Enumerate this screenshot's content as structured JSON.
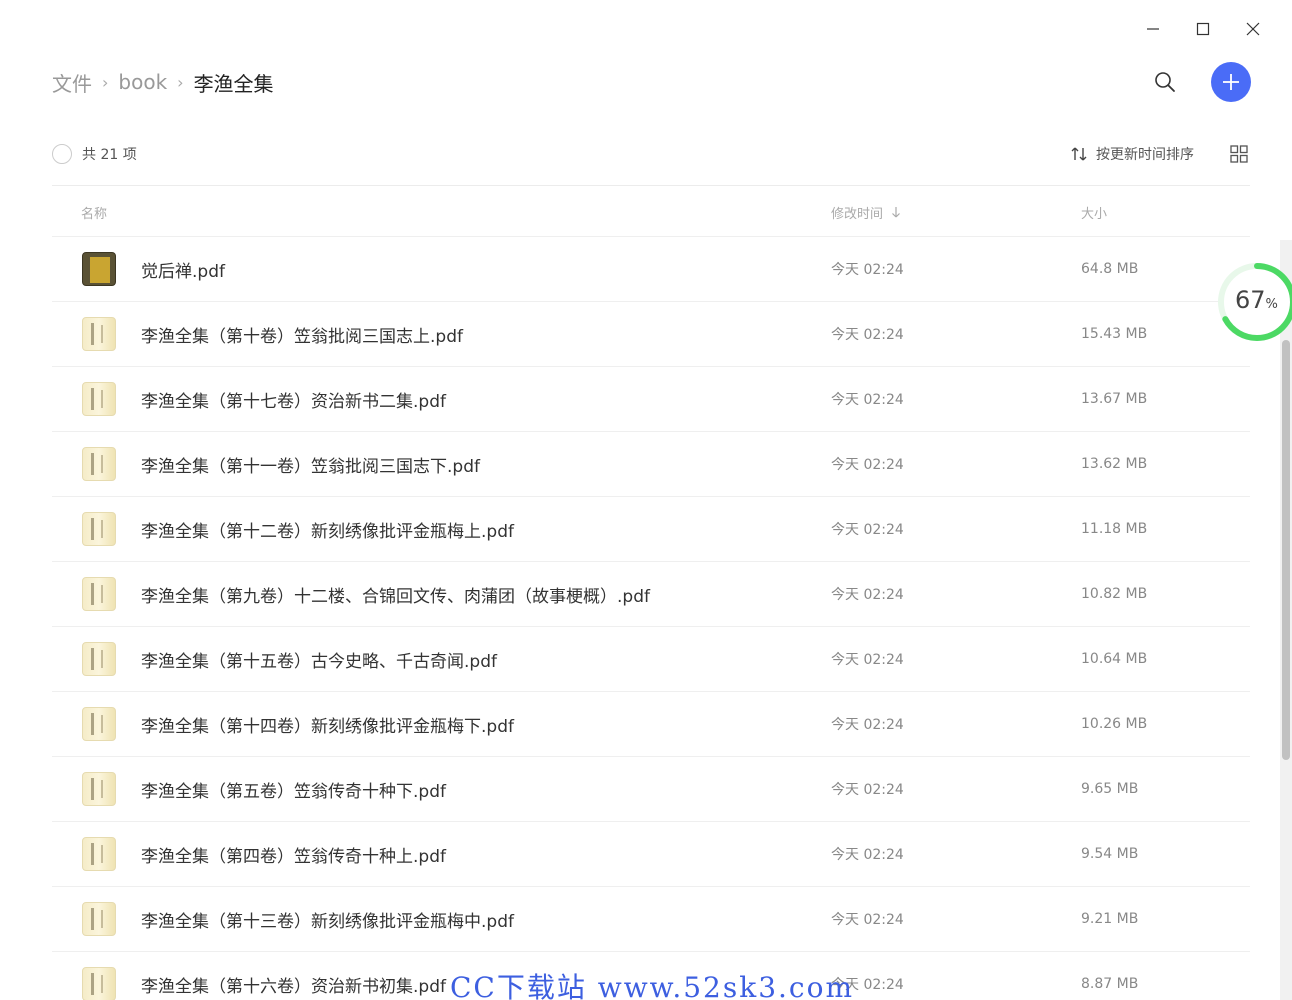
{
  "window": {
    "minimize_icon": "minimize-icon",
    "maximize_icon": "maximize-icon",
    "close_icon": "close-icon"
  },
  "breadcrumb": {
    "items": [
      "文件",
      "book",
      "李渔全集"
    ]
  },
  "header": {
    "search_icon": "search-icon",
    "add_icon": "plus-icon",
    "accent": "#4a6cf7"
  },
  "toolbar": {
    "count": "共 21 项",
    "sort_label": "按更新时间排序",
    "grid_icon": "grid-icon"
  },
  "columns": {
    "name": "名称",
    "time": "修改时间",
    "size": "大小"
  },
  "files": [
    {
      "name": "觉后禅.pdf",
      "time": "今天 02:24",
      "size": "64.8 MB",
      "thumb": "book"
    },
    {
      "name": "李渔全集（第十卷）笠翁批阅三国志上.pdf",
      "time": "今天 02:24",
      "size": "15.43 MB",
      "thumb": "scroll"
    },
    {
      "name": "李渔全集（第十七卷）资治新书二集.pdf",
      "time": "今天 02:24",
      "size": "13.67 MB",
      "thumb": "scroll"
    },
    {
      "name": "李渔全集（第十一卷）笠翁批阅三国志下.pdf",
      "time": "今天 02:24",
      "size": "13.62 MB",
      "thumb": "scroll"
    },
    {
      "name": "李渔全集（第十二卷）新刻绣像批评金瓶梅上.pdf",
      "time": "今天 02:24",
      "size": "11.18 MB",
      "thumb": "scroll"
    },
    {
      "name": "李渔全集（第九卷）十二楼、合锦回文传、肉蒲团（故事梗概）.pdf",
      "time": "今天 02:24",
      "size": "10.82 MB",
      "thumb": "scroll"
    },
    {
      "name": "李渔全集（第十五卷）古今史略、千古奇闻.pdf",
      "time": "今天 02:24",
      "size": "10.64 MB",
      "thumb": "scroll"
    },
    {
      "name": "李渔全集（第十四卷）新刻绣像批评金瓶梅下.pdf",
      "time": "今天 02:24",
      "size": "10.26 MB",
      "thumb": "scroll"
    },
    {
      "name": "李渔全集（第五卷）笠翁传奇十种下.pdf",
      "time": "今天 02:24",
      "size": "9.65 MB",
      "thumb": "scroll"
    },
    {
      "name": "李渔全集（第四卷）笠翁传奇十种上.pdf",
      "time": "今天 02:24",
      "size": "9.54 MB",
      "thumb": "scroll"
    },
    {
      "name": "李渔全集（第十三卷）新刻绣像批评金瓶梅中.pdf",
      "time": "今天 02:24",
      "size": "9.21 MB",
      "thumb": "scroll"
    },
    {
      "name": "李渔全集（第十六卷）资治新书初集.pdf",
      "time": "今天 02:24",
      "size": "8.87 MB",
      "thumb": "scroll"
    }
  ],
  "progress": {
    "value": "67",
    "unit": "%",
    "percent": 67,
    "color": "#4cd964"
  },
  "watermark": "CC下载站 www.52sk3.com"
}
